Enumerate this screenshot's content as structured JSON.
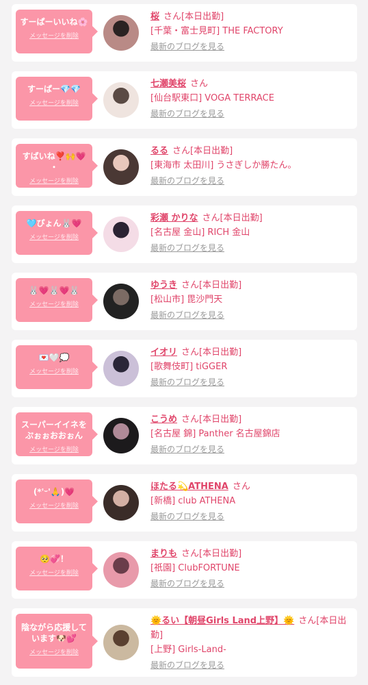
{
  "delete_label": "メッセージを削除",
  "blog_label": "最新のブログを見る",
  "san": "さん",
  "items": [
    {
      "message": "すーぱーいいね🌸",
      "name": "桜",
      "status": "[本日出勤]",
      "shop": "[千葉・富士見町] THE FACTORY",
      "colors": [
        "#b98a86",
        "#2a2222"
      ]
    },
    {
      "message": "すーぱー💎💎",
      "name": "七瀬美桜",
      "status": "",
      "shop": "[仙台駅東口] VOGA TERRACE",
      "colors": [
        "#efe4df",
        "#5a4a44"
      ]
    },
    {
      "message": "すばいね❣️🙌💗\n・",
      "name": "るる",
      "status": "[本日出勤]",
      "shop": "[東海市 太田川] うさぎしか勝たん。",
      "colors": [
        "#4a3834",
        "#e9c8bc"
      ]
    },
    {
      "message": "🩵ぴょん🐰💗",
      "name": "彩瀬 かりな",
      "status": "[本日出勤]",
      "shop": "[名古屋 金山] RICH 金山",
      "colors": [
        "#f4dce6",
        "#2b2333"
      ]
    },
    {
      "message": "🐰💗🐰💗🐰",
      "name": "ゆうき",
      "status": "[本日出勤]",
      "shop": "[松山市] 毘沙門天",
      "colors": [
        "#222222",
        "#7c6b64"
      ]
    },
    {
      "message": "💌🤍💭",
      "name": "イオリ",
      "status": "[本日出勤]",
      "shop": "[歌舞伎町] tiGGER",
      "colors": [
        "#cbc0d8",
        "#2a2638"
      ]
    },
    {
      "message": "スーパーイイネを\nぷぉぉおおぉん",
      "name": "こうめ",
      "status": "[本日出勤]",
      "shop": "[名古屋 錦] Panther 名古屋錦店",
      "colors": [
        "#1c1a1c",
        "#b08a98"
      ]
    },
    {
      "message": "(*'ᵕ'🙏)💗",
      "name": "ほたる💫ATHENA",
      "status": "",
      "shop": "[新橋] club ATHENA",
      "colors": [
        "#3a2c28",
        "#d3b0a4"
      ]
    },
    {
      "message": "🥺💞！",
      "name": "まりも",
      "status": "[本日出勤]",
      "shop": "[祇園] ClubFORTUNE",
      "colors": [
        "#e89aaa",
        "#6a3d4a"
      ]
    },
    {
      "message": "陰ながら応援して\nいます🐶💕",
      "name": "🌞るい【朝昼Girls Land上野】🌞",
      "status": "[本日出勤]",
      "shop": "[上野] Girls-Land-",
      "colors": [
        "#cbb9a0",
        "#5a4030"
      ]
    }
  ]
}
